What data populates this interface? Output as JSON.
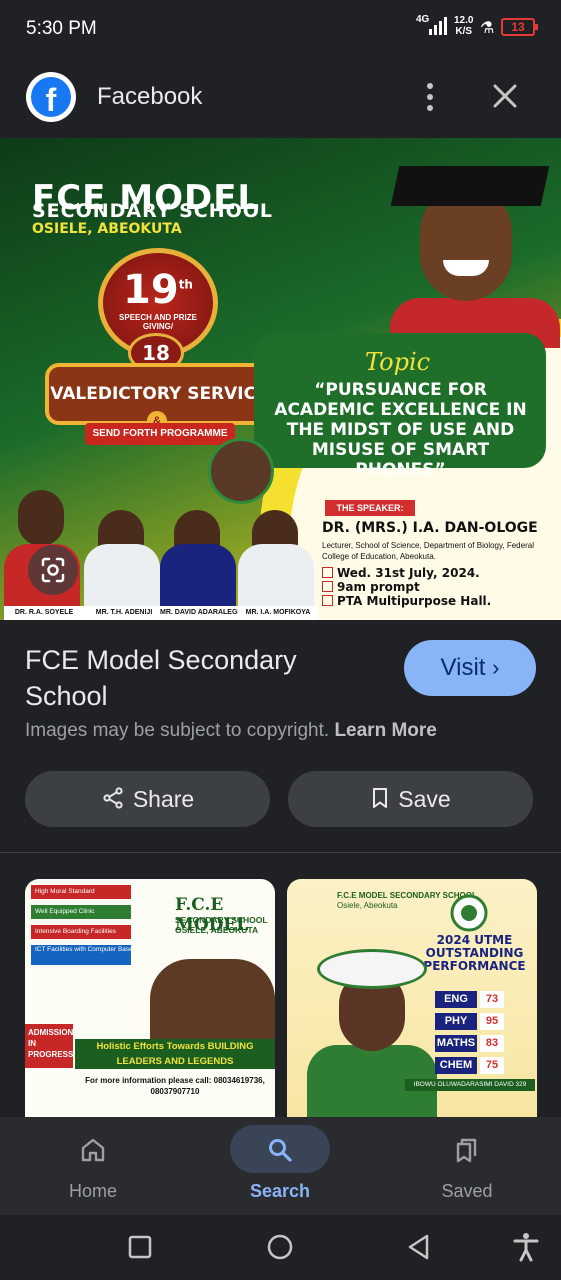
{
  "status_bar": {
    "time": "5:30 PM",
    "network": "4G",
    "speed_value": "12.0",
    "speed_unit": "K/S",
    "battery": "13"
  },
  "app_bar": {
    "title": "Facebook",
    "logo_letter": "f"
  },
  "hero_image": {
    "school_line1": "FCE MODEL",
    "school_line2": "SECONDARY SCHOOL",
    "location": "OSIELE, ABEOKUTA",
    "badge_number": "19",
    "badge_sup": "th",
    "badge_sub": "SPEECH AND PRIZE GIVING/",
    "badge2_number": "18",
    "ribbon_text": "VALEDICTORY SERVICE",
    "amp": "&",
    "send_forth": "SEND FORTH PROGRAMME",
    "topic_label": "Topic",
    "topic_text": "“PURSUANCE FOR ACADEMIC EXCELLENCE IN THE MIDST OF USE AND MISUSE OF SMART PHONES”",
    "speaker_label": "THE SPEAKER:",
    "speaker_name": "DR. (MRS.) I.A. DAN-OLOGE",
    "speaker_desc": "Lecturer, School of Science, Department of Biology, Federal College of Education, Abeokuta.",
    "event_date": "Wed. 31st July, 2024.",
    "event_time": "9am prompt",
    "event_venue": "PTA Multipurpose Hall.",
    "people": [
      "DR. R.A. SOYELE",
      "MR. T.H. ADENIJI",
      "MR. DAVID ADARALEGBE",
      "MR. I.A. MOFIKOYA"
    ]
  },
  "result": {
    "title": "FCE Model Secondary School",
    "visit_label": "Visit",
    "copyright_text": "Images may be subject to copyright.",
    "learn_more": "Learn More",
    "share_label": "Share",
    "save_label": "Save"
  },
  "thumbnails": [
    {
      "features": [
        "High Moral Standard",
        "Well Equipped Clinic",
        "Intensive Boarding Facilities",
        "ICT Facilities with Computer Based Test (CBT)"
      ],
      "title": "F.C.E MODEL",
      "subtitle": "SECONDARY SCHOOL",
      "location": "OSIELE, ABEOKUTA",
      "admission": "ADMISSION IN PROGRESS",
      "banner": "Holistic Efforts Towards BUILDING LEADERS AND LEGENDS",
      "contact": "For more information please call: 08034619736, 08037907710"
    },
    {
      "school": "F.C.E MODEL SECONDARY SCHOOL",
      "school_loc": "Osiele, Abeokuta",
      "heading": "2024 UTME OUTSTANDING PERFORMANCE",
      "scores": [
        {
          "subject": "ENG",
          "score": "73"
        },
        {
          "subject": "PHY",
          "score": "95"
        },
        {
          "subject": "MATHS",
          "score": "83"
        },
        {
          "subject": "CHEM",
          "score": "75"
        }
      ],
      "student_name": "IBOWU OLUWADARASIMI DAVID",
      "student_score": "329"
    }
  ],
  "bottom_nav": {
    "items": [
      {
        "label": "Home",
        "icon": "home-icon"
      },
      {
        "label": "Search",
        "icon": "search-icon"
      },
      {
        "label": "Saved",
        "icon": "saved-icon"
      }
    ]
  },
  "colors": {
    "background": "#202124",
    "accent": "#8ab4f8",
    "pill": "#3c4043",
    "facebook": "#1877f2"
  }
}
